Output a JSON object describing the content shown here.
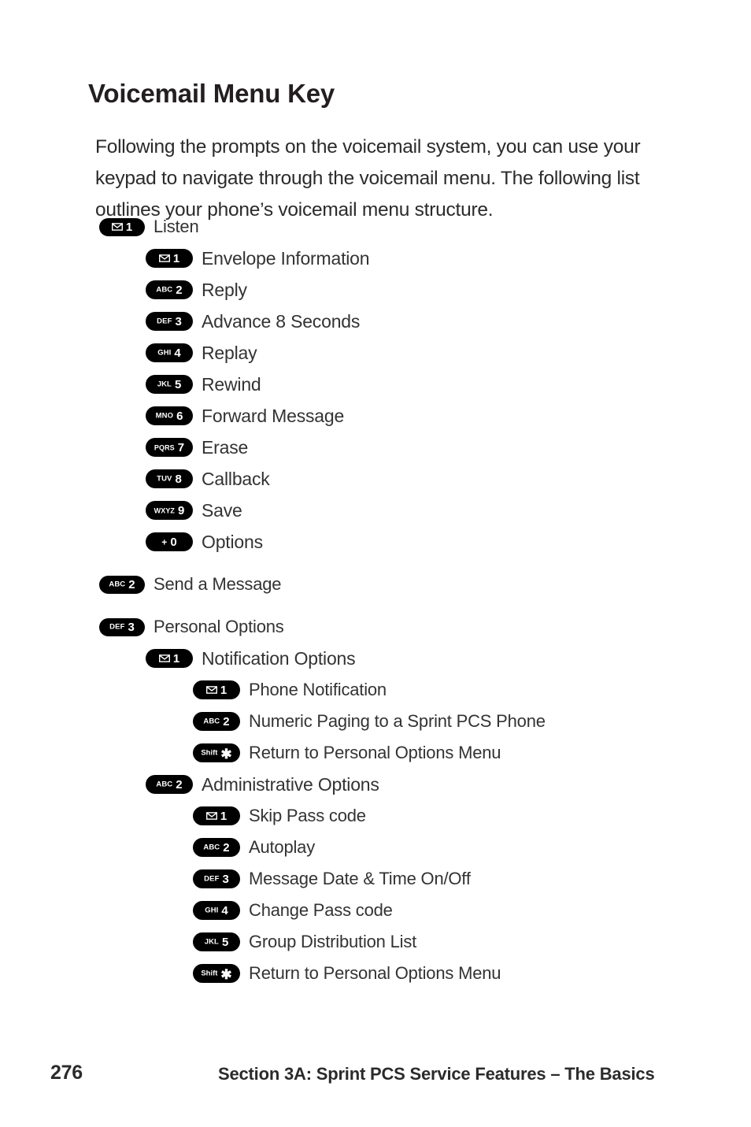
{
  "page": {
    "title": "Voicemail Menu Key",
    "intro": "Following the prompts on the voicemail system, you can use your keypad to navigate through the voicemail menu. The following list outlines your phone’s voicemail menu structure."
  },
  "menu": {
    "items": [
      {
        "level": 0,
        "gap": false,
        "key_letters": "",
        "key_icon": "envelope-icon",
        "key_digit": "1",
        "label": "Listen"
      },
      {
        "level": 1,
        "gap": false,
        "key_letters": "",
        "key_icon": "envelope-icon",
        "key_digit": "1",
        "label": "Envelope Information"
      },
      {
        "level": 1,
        "gap": false,
        "key_letters": "ABC",
        "key_icon": "",
        "key_digit": "2",
        "label": "Reply"
      },
      {
        "level": 1,
        "gap": false,
        "key_letters": "DEF",
        "key_icon": "",
        "key_digit": "3",
        "label": "Advance 8 Seconds"
      },
      {
        "level": 1,
        "gap": false,
        "key_letters": "GHI",
        "key_icon": "",
        "key_digit": "4",
        "label": "Replay"
      },
      {
        "level": 1,
        "gap": false,
        "key_letters": "JKL",
        "key_icon": "",
        "key_digit": "5",
        "label": "Rewind"
      },
      {
        "level": 1,
        "gap": false,
        "key_letters": "MNO",
        "key_icon": "",
        "key_digit": "6",
        "label": "Forward Message"
      },
      {
        "level": 1,
        "gap": false,
        "key_letters": "PQRS",
        "key_icon": "",
        "key_digit": "7",
        "label": "Erase"
      },
      {
        "level": 1,
        "gap": false,
        "key_letters": "TUV",
        "key_icon": "",
        "key_digit": "8",
        "label": "Callback"
      },
      {
        "level": 1,
        "gap": false,
        "key_letters": "WXYZ",
        "key_icon": "",
        "key_digit": "9",
        "label": "Save"
      },
      {
        "level": 1,
        "gap": false,
        "key_letters": "+",
        "key_icon": "",
        "key_digit": "0",
        "label": "Options"
      },
      {
        "level": 0,
        "gap": true,
        "key_letters": "ABC",
        "key_icon": "",
        "key_digit": "2",
        "label": "Send a Message"
      },
      {
        "level": 0,
        "gap": true,
        "key_letters": "DEF",
        "key_icon": "",
        "key_digit": "3",
        "label": "Personal Options"
      },
      {
        "level": 1,
        "gap": false,
        "key_letters": "",
        "key_icon": "envelope-icon",
        "key_digit": "1",
        "label": "Notification Options"
      },
      {
        "level": 2,
        "gap": false,
        "key_letters": "",
        "key_icon": "envelope-icon",
        "key_digit": "1",
        "label": "Phone Notification"
      },
      {
        "level": 2,
        "gap": false,
        "key_letters": "ABC",
        "key_icon": "",
        "key_digit": "2",
        "label": "Numeric Paging to a Sprint PCS Phone"
      },
      {
        "level": 2,
        "gap": false,
        "key_letters": "Shift",
        "key_icon": "",
        "key_digit": "✱",
        "label": "Return to Personal Options Menu"
      },
      {
        "level": 1,
        "gap": false,
        "key_letters": "ABC",
        "key_icon": "",
        "key_digit": "2",
        "label": "Administrative Options"
      },
      {
        "level": 2,
        "gap": false,
        "key_letters": "",
        "key_icon": "envelope-icon",
        "key_digit": "1",
        "label": "Skip Pass code"
      },
      {
        "level": 2,
        "gap": false,
        "key_letters": "ABC",
        "key_icon": "",
        "key_digit": "2",
        "label": "Autoplay"
      },
      {
        "level": 2,
        "gap": false,
        "key_letters": "DEF",
        "key_icon": "",
        "key_digit": "3",
        "label": "Message Date & Time On/Off"
      },
      {
        "level": 2,
        "gap": false,
        "key_letters": "GHI",
        "key_icon": "",
        "key_digit": "4",
        "label": "Change Pass code"
      },
      {
        "level": 2,
        "gap": false,
        "key_letters": "JKL",
        "key_icon": "",
        "key_digit": "5",
        "label": "Group Distribution List"
      },
      {
        "level": 2,
        "gap": false,
        "key_letters": "Shift",
        "key_icon": "",
        "key_digit": "✱",
        "label": "Return to Personal Options Menu"
      }
    ]
  },
  "footer": {
    "page_number": "276",
    "section": "Section 3A: Sprint PCS Service Features – The Basics"
  },
  "colors": {
    "key_background": "#000000",
    "key_text": "#ffffff",
    "heading": "#231f20",
    "body_text": "#333333",
    "page_background": "#ffffff"
  }
}
